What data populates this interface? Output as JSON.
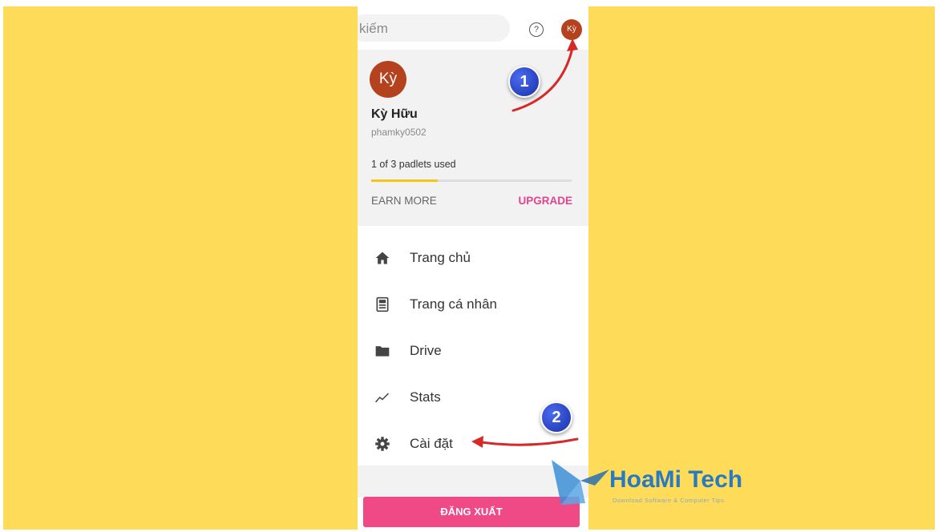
{
  "search": {
    "placeholder_text": "kiếm"
  },
  "header": {
    "help_symbol": "?",
    "avatar_initials": "Kỳ"
  },
  "profile": {
    "avatar_initials": "Kỳ",
    "name": "Kỳ Hữu",
    "username": "phamky0502",
    "usage_text": "1 of 3 padlets used",
    "usage_fraction": 0.333,
    "earn_more_label": "EARN MORE",
    "upgrade_label": "UPGRADE"
  },
  "menu": {
    "items": [
      {
        "label": "Trang chủ",
        "icon": "home-icon"
      },
      {
        "label": "Trang cá nhân",
        "icon": "profile-page-icon"
      },
      {
        "label": "Drive",
        "icon": "folder-icon"
      },
      {
        "label": "Stats",
        "icon": "stats-icon"
      },
      {
        "label": "Cài đặt",
        "icon": "gear-icon"
      }
    ]
  },
  "logout": {
    "label": "ĐĂNG XUẤT"
  },
  "annotations": {
    "step1": "1",
    "step2": "2"
  },
  "watermark": {
    "brand": "HoaMi Tech",
    "tagline": "Download Software & Computer Tips"
  },
  "colors": {
    "background": "#fedc5a",
    "avatar": "#b5421e",
    "upgrade": "#e4438e",
    "logout_button": "#ef4a86",
    "usage_bar": "#f5c518",
    "annotation_arrow": "#d42a2a",
    "annotation_badge": "#1a2fa8"
  }
}
